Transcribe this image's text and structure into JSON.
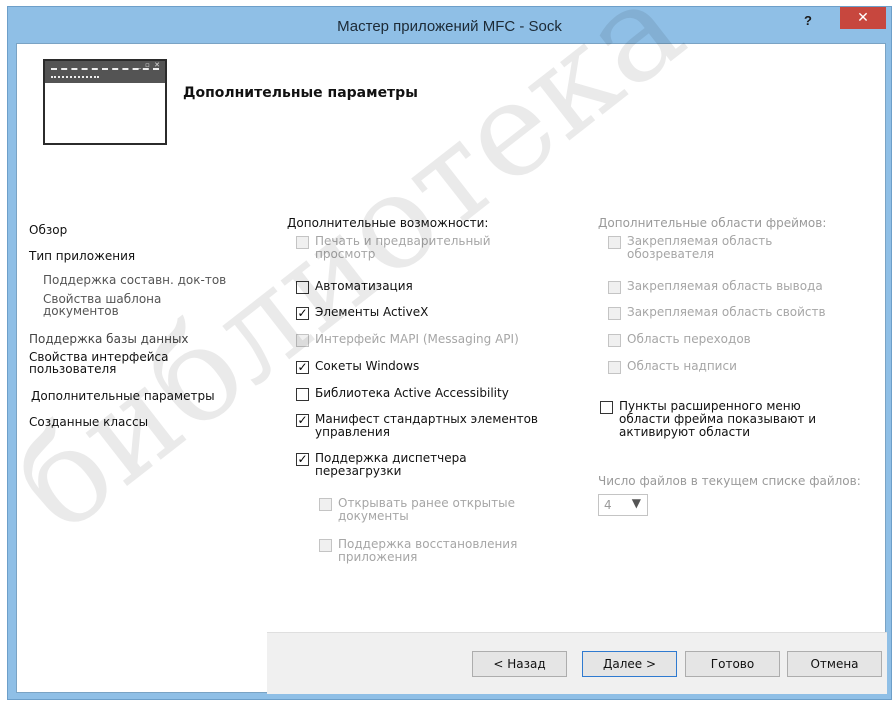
{
  "window": {
    "title": "Мастер приложений MFC - Sock",
    "help_label": "?",
    "close_label": "✕"
  },
  "header": {
    "title": "Дополнительные параметры",
    "icon": "wizard-window-icon"
  },
  "nav": {
    "items": [
      {
        "label": "Обзор"
      },
      {
        "label": "Тип приложения"
      },
      {
        "label": "Поддержка составн. док-тов"
      },
      {
        "label": "Свойства шаблона документов"
      },
      {
        "label": "Поддержка базы данных"
      },
      {
        "label": "Свойства интерфейса пользователя"
      },
      {
        "label": "Дополнительные параметры"
      },
      {
        "label": "Созданные классы"
      }
    ]
  },
  "features": {
    "title": "Дополнительные возможности:",
    "options": [
      {
        "label": "Печать и предварительный просмотр",
        "checked": false,
        "enabled": false
      },
      {
        "label": "Автоматизация",
        "checked": false,
        "enabled": true
      },
      {
        "label": "Элементы ActiveX",
        "checked": true,
        "enabled": true
      },
      {
        "label": "Интерфейс MAPI (Messaging API)",
        "checked": false,
        "enabled": false
      },
      {
        "label": "Сокеты Windows",
        "checked": true,
        "enabled": true
      },
      {
        "label": "Библиотека Active Accessibility",
        "checked": false,
        "enabled": true
      },
      {
        "label": "Манифест стандартных элементов управления",
        "checked": true,
        "enabled": true
      },
      {
        "label": "Поддержка диспетчера перезагрузки",
        "checked": true,
        "enabled": true
      },
      {
        "label": "Открывать ранее открытые документы",
        "checked": false,
        "enabled": false
      },
      {
        "label": "Поддержка восстановления приложения",
        "checked": false,
        "enabled": false
      }
    ]
  },
  "frames": {
    "title": "Дополнительные области фреймов:",
    "options": [
      {
        "label": "Закрепляемая область обозревателя",
        "checked": false,
        "enabled": false
      },
      {
        "label": "Закрепляемая область вывода",
        "checked": false,
        "enabled": false
      },
      {
        "label": "Закрепляемая область свойств",
        "checked": false,
        "enabled": false
      },
      {
        "label": "Область переходов",
        "checked": false,
        "enabled": false
      },
      {
        "label": "Область надписи",
        "checked": false,
        "enabled": false
      }
    ],
    "menu_option": {
      "label": "Пункты расширенного меню области фрейма показывают и активируют области",
      "checked": false,
      "enabled": true
    }
  },
  "recent_files": {
    "label": "Число файлов в текущем списке файлов:",
    "value": "4"
  },
  "footer": {
    "back": "< Назад",
    "next": "Далее >",
    "finish": "Готово",
    "cancel": "Отмена"
  },
  "watermark": "библиотека",
  "check_mark": "✓",
  "colors": {
    "titlebar": "#8fbfe6",
    "close": "#c7473e",
    "disabled_text": "#a6a6a6"
  }
}
